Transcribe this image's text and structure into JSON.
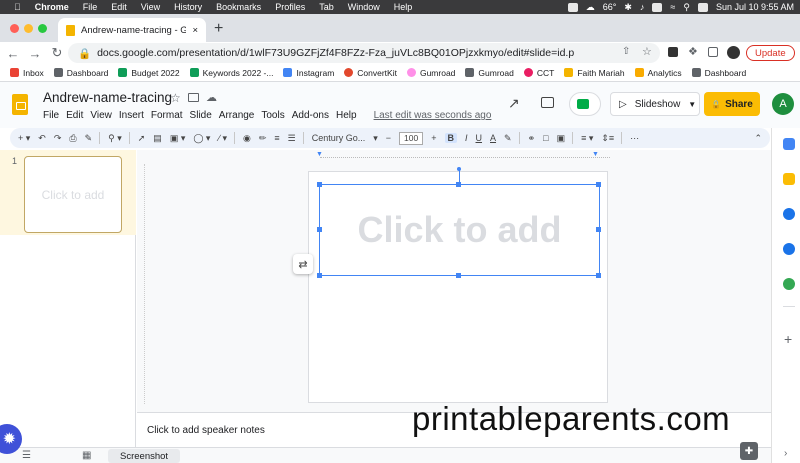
{
  "macbar": {
    "items": [
      "Chrome",
      "File",
      "Edit",
      "View",
      "History",
      "Bookmarks",
      "Profiles",
      "Tab",
      "Window",
      "Help"
    ],
    "weather": "66°",
    "clock": "Sun Jul 10  9:55 AM"
  },
  "tab": {
    "title": "Andrew-name-tracing - Googl",
    "new_tab": "+"
  },
  "address": {
    "url": "docs.google.com/presentation/d/1wlF73U9GZFjZf4F8FZz-Fza_juVLc8BQ01OPjzxkmyo/edit#slide=id.p",
    "update_label": "Update"
  },
  "bookmarks": [
    {
      "label": "Inbox",
      "color": "#ea4335"
    },
    {
      "label": "Dashboard",
      "color": "#5f6368"
    },
    {
      "label": "Budget 2022",
      "color": "#0f9d58"
    },
    {
      "label": "Keywords 2022 -...",
      "color": "#0f9d58"
    },
    {
      "label": "Instagram",
      "color": "#4285f4"
    },
    {
      "label": "ConvertKit",
      "color": "#e2482d"
    },
    {
      "label": "Gumroad",
      "color": "#ff90e8"
    },
    {
      "label": "Gumroad",
      "color": "#5f6368"
    },
    {
      "label": "CCT",
      "color": "#e91e63"
    },
    {
      "label": "Faith Mariah",
      "color": "#f4b400"
    },
    {
      "label": "Analytics",
      "color": "#f9ab00"
    },
    {
      "label": "Dashboard",
      "color": "#5f6368"
    }
  ],
  "doc": {
    "title": "Andrew-name-tracing",
    "menus": [
      "File",
      "Edit",
      "View",
      "Insert",
      "Format",
      "Slide",
      "Arrange",
      "Tools",
      "Add-ons",
      "Help"
    ],
    "last_edit": "Last edit was seconds ago",
    "slideshow_label": "Slideshow",
    "share_label": "Share",
    "avatar_letter": "A"
  },
  "toolbar": {
    "font": "Century Go...",
    "font_size": "100"
  },
  "filmstrip": {
    "slide_number": "1",
    "placeholder": "Click to add"
  },
  "slide": {
    "placeholder": "Click to add"
  },
  "notes": {
    "placeholder": "Click to add speaker notes"
  },
  "bottom": {
    "screenshot_label": "Screenshot"
  },
  "watermark": "printableparents.com",
  "colors": {
    "accent": "#4285f4",
    "share": "#fbbc04",
    "logo": "#f4b400"
  }
}
